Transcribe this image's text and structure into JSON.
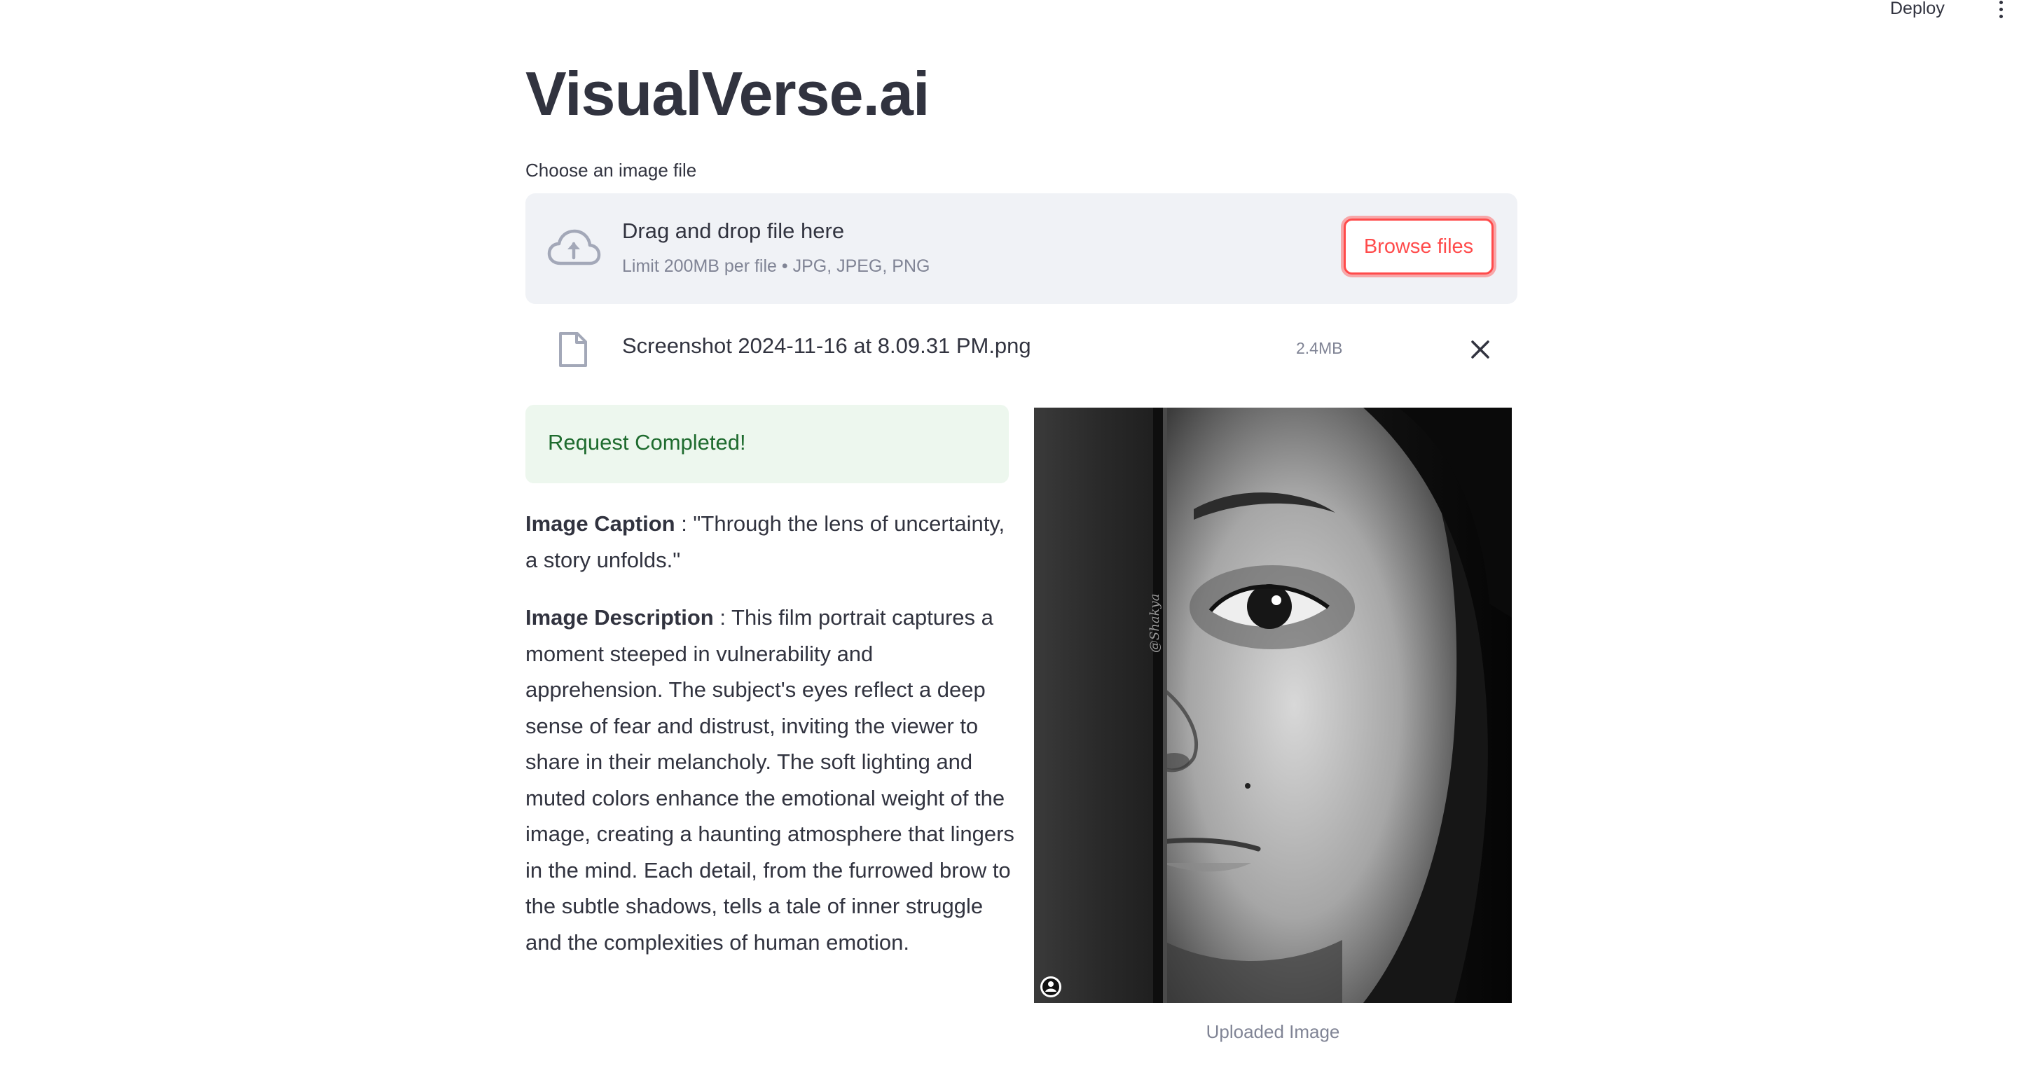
{
  "header": {
    "deploy_label": "Deploy",
    "menu_icon": "more-vert-icon"
  },
  "app": {
    "title": "VisualVerse.ai"
  },
  "uploader": {
    "label": "Choose an image file",
    "drop_title": "Drag and drop file here",
    "drop_subtitle": "Limit 200MB per file • JPG, JPEG, PNG",
    "browse_label": "Browse files",
    "icon": "cloud-upload-icon",
    "accent_color": "#ff4b4b",
    "background_color": "#f0f2f6"
  },
  "uploaded_file": {
    "name": "Screenshot 2024-11-16 at 8.09.31 PM.png",
    "size": "2.4MB",
    "icon": "file-icon",
    "remove_icon": "close-icon"
  },
  "status": {
    "message": "Request Completed!",
    "color": "#1e6b2e",
    "background": "#edf7ee"
  },
  "result": {
    "caption_label": "Image Caption",
    "caption_text": " : \"Through the lens of uncertainty, a story unfolds.\"",
    "description_label": "Image Description",
    "description_text": " : This film portrait captures a moment steeped in vulnerability and apprehension. The subject's eyes reflect a deep sense of fear and distrust, inviting the viewer to share in their melancholy. The soft lighting and muted colors enhance the emotional weight of the image, creating a haunting atmosphere that lingers in the mind. Each detail, from the furrowed brow to the subtle shadows, tells a tale of inner struggle and the complexities of human emotion."
  },
  "image": {
    "caption": "Uploaded Image",
    "watermark": "@Shakya"
  }
}
